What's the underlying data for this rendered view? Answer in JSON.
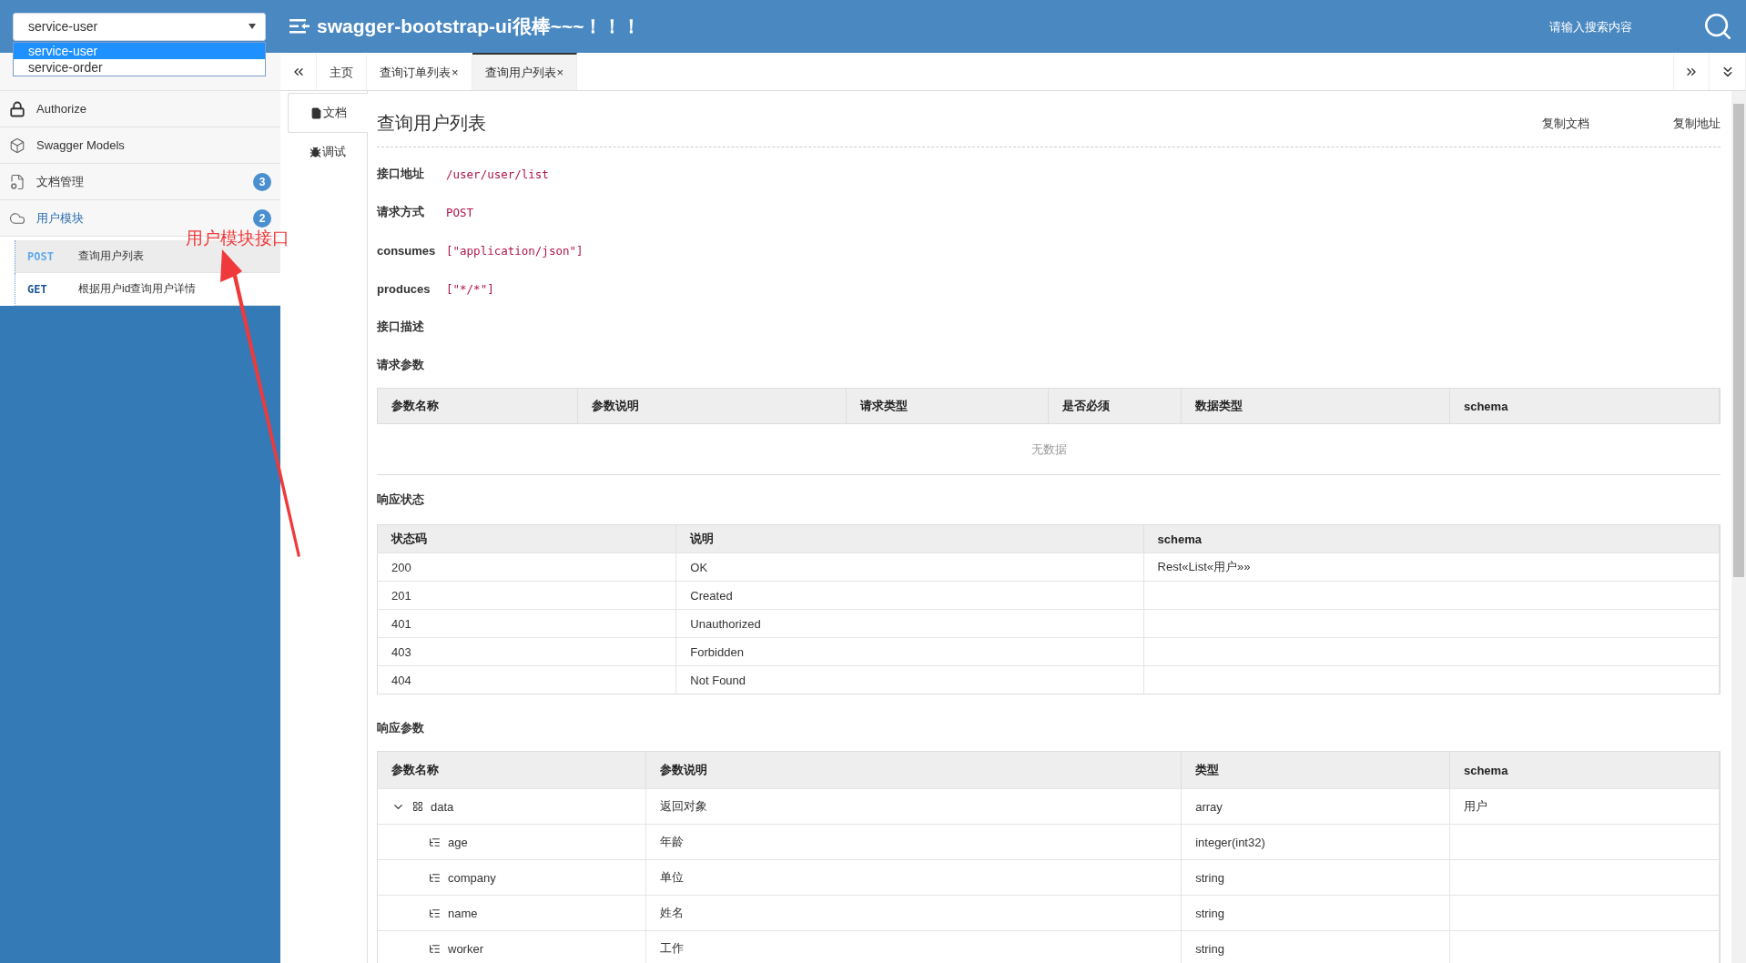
{
  "service_select": {
    "value": "service-user",
    "options": [
      {
        "label": "service-user",
        "selected": true
      },
      {
        "label": "service-order",
        "selected": false
      }
    ]
  },
  "header": {
    "title": "swagger-bootstrap-ui很棒~~~！！！",
    "search": {
      "placeholder": "请输入搜索内容"
    }
  },
  "sidebar": {
    "items": [
      {
        "label": "Authorize"
      },
      {
        "label": "Swagger Models"
      },
      {
        "label": "文档管理",
        "badge": "3"
      },
      {
        "label": "用户模块",
        "badge": "2",
        "expanded": true,
        "children": [
          {
            "method": "POST",
            "color": "#5fa8ee",
            "label": "查询用户列表",
            "selected": true
          },
          {
            "method": "GET",
            "color": "#1c5697",
            "label": "根据用户id查询用户详情",
            "selected": false
          }
        ]
      }
    ]
  },
  "annotation": {
    "text": "用户模块接口"
  },
  "tabs": [
    {
      "label": "主页",
      "selected": false
    },
    {
      "label": "查询订单列表",
      "close": "×",
      "selected": false
    },
    {
      "label": "查询用户列表",
      "close": "×",
      "selected": true
    }
  ],
  "doc_tabs": [
    {
      "label": "文档",
      "selected": true
    },
    {
      "label": "调试",
      "selected": false
    }
  ],
  "doc": {
    "title": "查询用户列表",
    "actions": [
      "复制文档",
      "复制地址"
    ],
    "fields": [
      {
        "label": "接口地址",
        "value": "/user/user/list"
      },
      {
        "label": "请求方式",
        "value": "POST"
      },
      {
        "label": "consumes",
        "value": "[\"application/json\"]"
      },
      {
        "label": "produces",
        "value": "[\"*/*\"]"
      },
      {
        "label": "接口描述"
      }
    ],
    "request_params": {
      "title": "请求参数",
      "columns": [
        "参数名称",
        "参数说明",
        "请求类型",
        "是否必须",
        "数据类型",
        "schema"
      ],
      "empty_text": "无数据"
    },
    "response_status": {
      "title": "响应状态",
      "columns": [
        "状态码",
        "说明",
        "schema"
      ],
      "rows": [
        [
          "200",
          "OK",
          "Rest«List«用户»»"
        ],
        [
          "201",
          "Created",
          ""
        ],
        [
          "401",
          "Unauthorized",
          ""
        ],
        [
          "403",
          "Forbidden",
          ""
        ],
        [
          "404",
          "Not Found",
          ""
        ]
      ]
    },
    "response_params": {
      "title": "响应参数",
      "columns": [
        "参数名称",
        "参数说明",
        "类型",
        "schema"
      ],
      "rows": [
        {
          "name": "data",
          "description": "返回对象",
          "type": "array",
          "schema": "用户",
          "expanded": true,
          "children": [
            {
              "name": "age",
              "description": "年龄",
              "type": "integer(int32)"
            },
            {
              "name": "company",
              "description": "单位",
              "type": "string"
            },
            {
              "name": "name",
              "description": "姓名",
              "type": "string"
            },
            {
              "name": "worker",
              "description": "工作",
              "type": "string"
            }
          ]
        }
      ]
    }
  }
}
